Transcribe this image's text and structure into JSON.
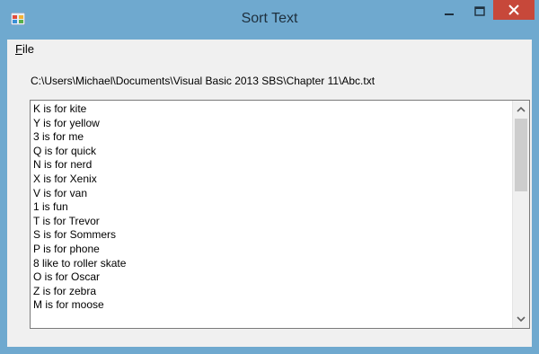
{
  "window": {
    "title": "Sort Text",
    "icon": "app-icon",
    "controls": [
      "minimize-icon",
      "maximize-icon",
      "close-icon"
    ],
    "close_color": "#c7483a",
    "frame_color": "#6fa9cf"
  },
  "menu": {
    "file": {
      "accel": "F",
      "rest": "ile"
    }
  },
  "path_label": "C:\\Users\\Michael\\Documents\\Visual Basic 2013 SBS\\Chapter 11\\Abc.txt",
  "textbox": {
    "lines": [
      "K is for kite",
      "Y is for yellow",
      "3 is for me",
      "Q is for quick",
      "N is for nerd",
      "X is for Xenix",
      "V is for van",
      "1 is fun",
      "T is for Trevor",
      "S is for Sommers",
      "P is for phone",
      "8 like to roller skate",
      "O is for Oscar",
      "Z is for zebra",
      "M is for moose"
    ]
  }
}
